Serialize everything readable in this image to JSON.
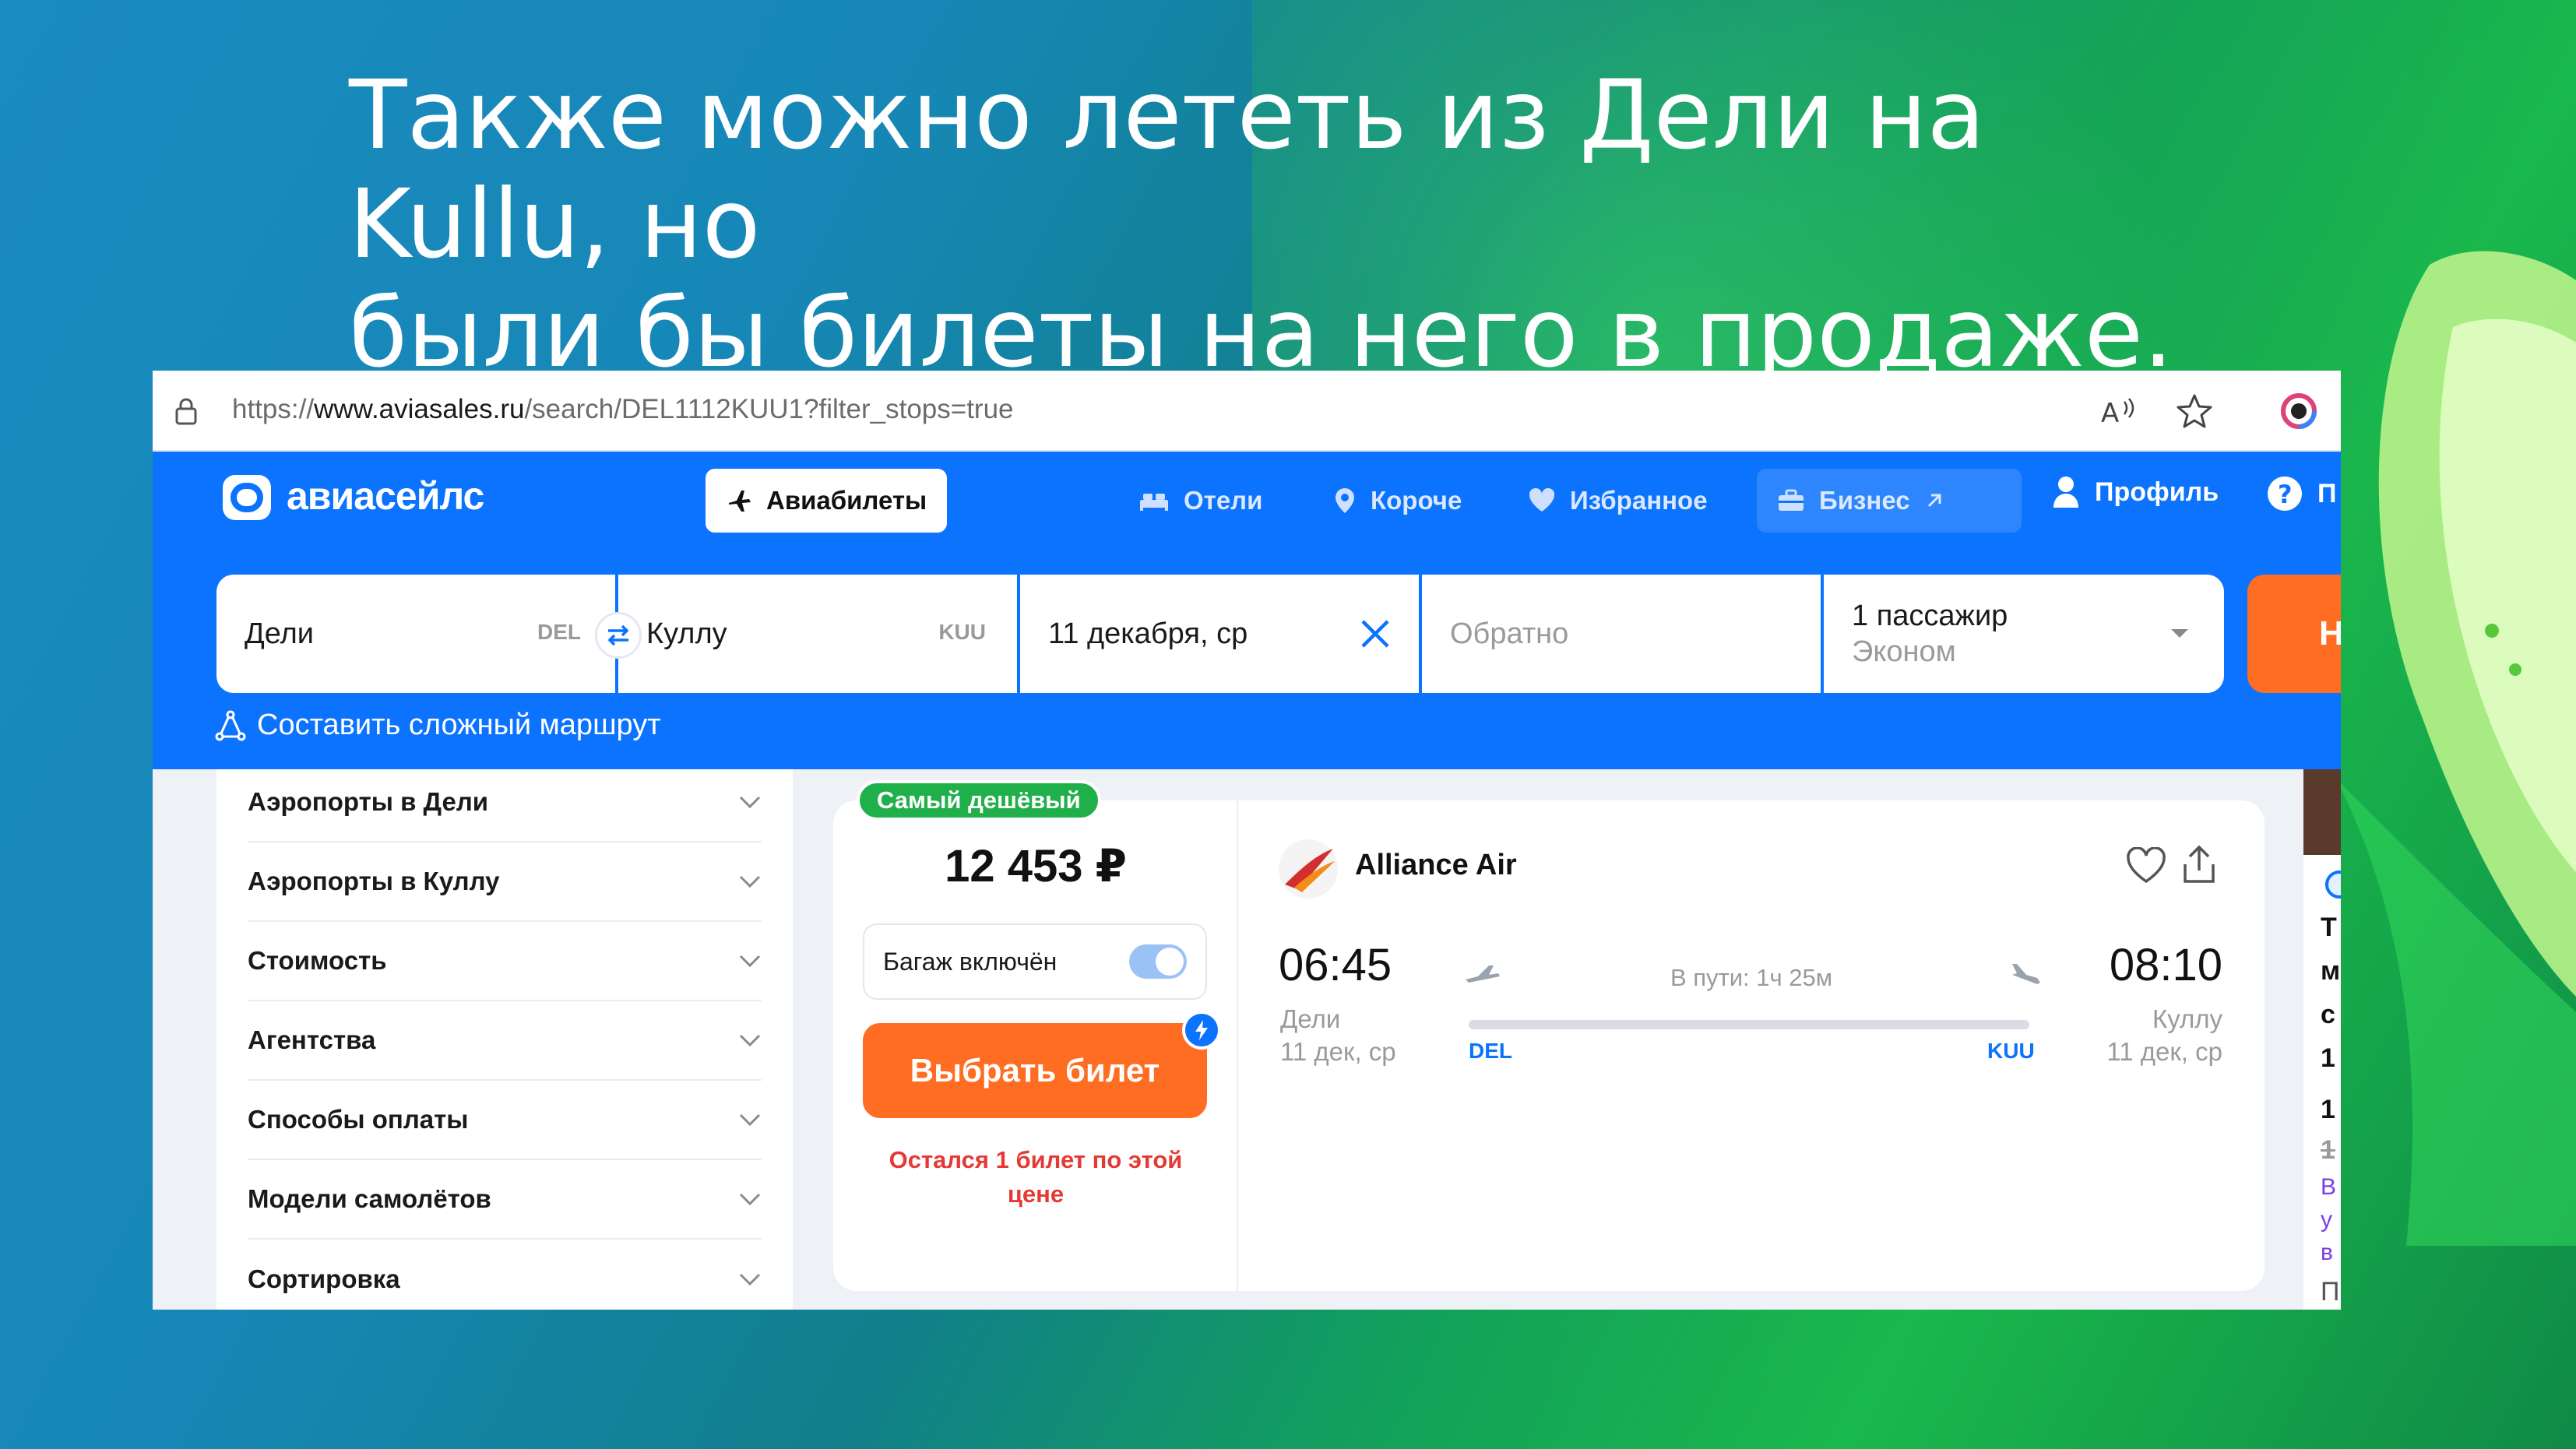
{
  "slide": {
    "title_line1": "Также можно лететь из Дели на Kullu, но",
    "title_line2": "были бы билеты на него в продаже."
  },
  "browser": {
    "url_prefix": "https://",
    "url_domain": "www.aviasales.ru",
    "url_path": "/search/DEL1112KUU1?filter_stops=true",
    "icons": [
      "lock-icon",
      "read-aloud-icon",
      "favorite-star-icon",
      "extension-icon"
    ]
  },
  "nav": {
    "brand": "авиасейлс",
    "tabs": [
      {
        "label": "Авиабилеты",
        "icon": "plane-icon",
        "active": true
      },
      {
        "label": "Отели",
        "icon": "bed-icon"
      },
      {
        "label": "Короче",
        "icon": "pin-icon"
      },
      {
        "label": "Избранное",
        "icon": "heart-icon"
      },
      {
        "label": "Бизнес",
        "icon": "briefcase-icon"
      }
    ],
    "profile": "Профиль",
    "help": "П"
  },
  "search": {
    "from": {
      "city": "Дели",
      "code": "DEL"
    },
    "to": {
      "city": "Куллу",
      "code": "KUU"
    },
    "date": "11 декабря, ср",
    "return_placeholder": "Обратно",
    "passengers": "1 пассажир",
    "cabin": "Эконом",
    "find_button": "Н",
    "complex_route": "Составить сложный маршрут"
  },
  "filters": [
    "Аэропорты в Дели",
    "Аэропорты в Куллу",
    "Стоимость",
    "Агентства",
    "Способы оплаты",
    "Модели самолётов",
    "Сортировка"
  ],
  "ticket": {
    "badge": "Самый дешёвый",
    "price": "12 453 ₽",
    "baggage": "Багаж включён",
    "baggage_on": true,
    "buy": "Выбрать билет",
    "warning": "Остался 1 билет по этой цене",
    "airline": "Alliance Air",
    "depart_time": "06:45",
    "depart_city": "Дели",
    "depart_date": "11 дек, ср",
    "arrive_time": "08:10",
    "arrive_city": "Куллу",
    "arrive_date": "11 дек, ср",
    "duration": "В пути: 1ч 25м",
    "from_code": "DEL",
    "to_code": "KUU"
  },
  "right_strip": {
    "letters": [
      "Т",
      "м",
      "с",
      "1",
      "1",
      "1"
    ],
    "purple": [
      "В",
      "у",
      "в"
    ],
    "bottom": "П"
  },
  "colors": {
    "brand_blue": "#0c73fe",
    "accent_orange": "#ff6d22",
    "badge_green": "#20b04b",
    "warning_red": "#e53935"
  }
}
